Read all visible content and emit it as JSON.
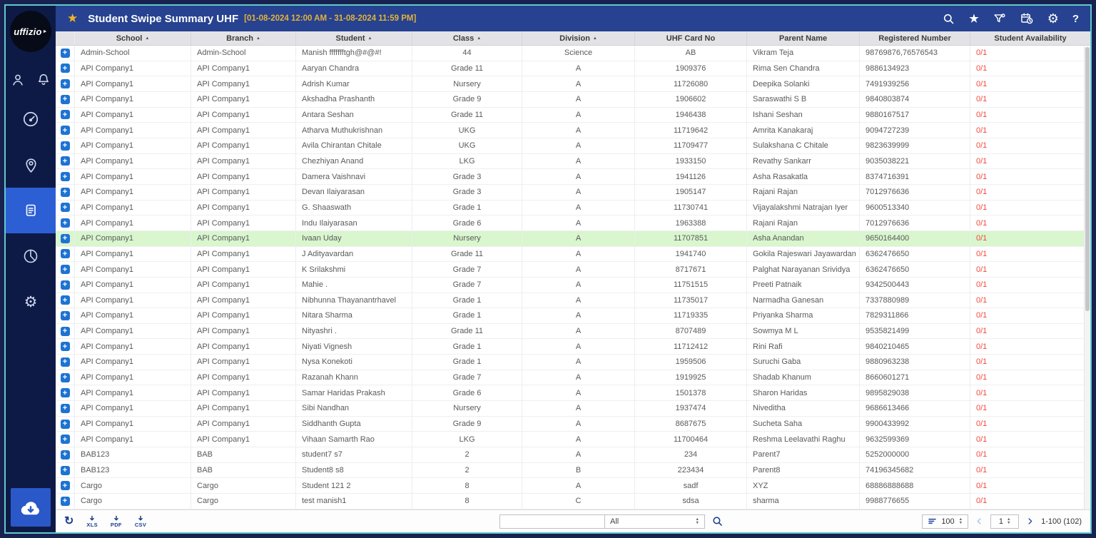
{
  "colors": {
    "frame_navy": "#182250",
    "accent_teal": "#62c9cc",
    "sidebar_navy": "#0e1a46",
    "active_blue": "#2c5fd4",
    "topbar_blue": "#264290",
    "gold": "#e3b23a",
    "highlight_green": "#d9f6ce",
    "availability_red": "#f0483c",
    "expand_blue": "#1e73d2"
  },
  "sidebar": {
    "logo_text": "uffizio",
    "items": [
      {
        "label": "users",
        "icon": "person-icon"
      },
      {
        "label": "notifications",
        "icon": "bell-icon"
      },
      {
        "label": "dashboard",
        "icon": "speedometer-icon"
      },
      {
        "label": "tracking",
        "icon": "location-person-icon"
      },
      {
        "label": "reports",
        "icon": "report-icon",
        "active": true
      },
      {
        "label": "analytics",
        "icon": "pie-chart-icon"
      },
      {
        "label": "settings",
        "icon": "gear-icon"
      },
      {
        "label": "download",
        "icon": "cloud-download-icon"
      }
    ]
  },
  "header": {
    "title": "Student Swipe Summary UHF",
    "date_range": "[01-08-2024 12:00 AM - 31-08-2024 11:59 PM]",
    "icons": [
      "search-icon",
      "favorite-star-icon",
      "filter-icon",
      "calendar-clock-icon",
      "gear-icon",
      "help-icon"
    ],
    "help_glyph": "?",
    "gear_glyph": "⚙"
  },
  "table": {
    "columns": [
      {
        "label": "",
        "sortable": false
      },
      {
        "label": "School",
        "sortable": true
      },
      {
        "label": "Branch",
        "sortable": true
      },
      {
        "label": "Student",
        "sortable": true
      },
      {
        "label": "Class",
        "sortable": true
      },
      {
        "label": "Division",
        "sortable": true
      },
      {
        "label": "UHF Card No",
        "sortable": false
      },
      {
        "label": "Parent Name",
        "sortable": false
      },
      {
        "label": "Registered Number",
        "sortable": false
      },
      {
        "label": "Student Availability",
        "sortable": false
      }
    ],
    "sort_asc_glyph": "▲",
    "highlighted_row_index": 12,
    "rows": [
      {
        "school": "Admin-School",
        "branch": "Admin-School",
        "student": "Manish ffffffftgh@#@#!",
        "klass": "44",
        "division": "Science",
        "uhf": "AB",
        "parent": "Vikram Teja",
        "registered": "98769876,76576543",
        "availability": "0/1"
      },
      {
        "school": "API Company1",
        "branch": "API Company1",
        "student": "Aaryan Chandra",
        "klass": "Grade 11",
        "division": "A",
        "uhf": "1909376",
        "parent": "Rima Sen Chandra",
        "registered": "9886134923",
        "availability": "0/1"
      },
      {
        "school": "API Company1",
        "branch": "API Company1",
        "student": "Adrish Kumar",
        "klass": "Nursery",
        "division": "A",
        "uhf": "11726080",
        "parent": "Deepika Solanki",
        "registered": "7491939256",
        "availability": "0/1"
      },
      {
        "school": "API Company1",
        "branch": "API Company1",
        "student": "Akshadha Prashanth",
        "klass": "Grade 9",
        "division": "A",
        "uhf": "1906602",
        "parent": "Saraswathi S B",
        "registered": "9840803874",
        "availability": "0/1"
      },
      {
        "school": "API Company1",
        "branch": "API Company1",
        "student": "Antara Seshan",
        "klass": "Grade 11",
        "division": "A",
        "uhf": "1946438",
        "parent": "Ishani Seshan",
        "registered": "9880167517",
        "availability": "0/1"
      },
      {
        "school": "API Company1",
        "branch": "API Company1",
        "student": "Atharva Muthukrishnan",
        "klass": "UKG",
        "division": "A",
        "uhf": "11719642",
        "parent": "Amrita Kanakaraj",
        "registered": "9094727239",
        "availability": "0/1"
      },
      {
        "school": "API Company1",
        "branch": "API Company1",
        "student": "Avila Chirantan Chitale",
        "klass": "UKG",
        "division": "A",
        "uhf": "11709477",
        "parent": "Sulakshana C Chitale",
        "registered": "9823639999",
        "availability": "0/1"
      },
      {
        "school": "API Company1",
        "branch": "API Company1",
        "student": "Chezhiyan Anand",
        "klass": "LKG",
        "division": "A",
        "uhf": "1933150",
        "parent": "Revathy Sankarr",
        "registered": "9035038221",
        "availability": "0/1"
      },
      {
        "school": "API Company1",
        "branch": "API Company1",
        "student": "Damera Vaishnavi",
        "klass": "Grade 3",
        "division": "A",
        "uhf": "1941126",
        "parent": "Asha Rasakatla",
        "registered": "8374716391",
        "availability": "0/1"
      },
      {
        "school": "API Company1",
        "branch": "API Company1",
        "student": "Devan Ilaiyarasan",
        "klass": "Grade 3",
        "division": "A",
        "uhf": "1905147",
        "parent": "Rajani Rajan",
        "registered": "7012976636",
        "availability": "0/1"
      },
      {
        "school": "API Company1",
        "branch": "API Company1",
        "student": "G. Shaaswath",
        "klass": "Grade 1",
        "division": "A",
        "uhf": "11730741",
        "parent": "Vijayalakshmi Natrajan Iyer",
        "registered": "9600513340",
        "availability": "0/1"
      },
      {
        "school": "API Company1",
        "branch": "API Company1",
        "student": "Indu Ilaiyarasan",
        "klass": "Grade 6",
        "division": "A",
        "uhf": "1963388",
        "parent": "Rajani Rajan",
        "registered": "7012976636",
        "availability": "0/1"
      },
      {
        "school": "API Company1",
        "branch": "API Company1",
        "student": "Ivaan Uday",
        "klass": "Nursery",
        "division": "A",
        "uhf": "11707851",
        "parent": "Asha Anandan",
        "registered": "9650164400",
        "availability": "0/1"
      },
      {
        "school": "API Company1",
        "branch": "API Company1",
        "student": "J Adityavardan",
        "klass": "Grade 11",
        "division": "A",
        "uhf": "1941740",
        "parent": "Gokila Rajeswari Jayawardan",
        "registered": "6362476650",
        "availability": "0/1"
      },
      {
        "school": "API Company1",
        "branch": "API Company1",
        "student": "K Srilakshmi",
        "klass": "Grade 7",
        "division": "A",
        "uhf": "8717671",
        "parent": "Palghat Narayanan Srividya",
        "registered": "6362476650",
        "availability": "0/1"
      },
      {
        "school": "API Company1",
        "branch": "API Company1",
        "student": "Mahie .",
        "klass": "Grade 7",
        "division": "A",
        "uhf": "11751515",
        "parent": "Preeti Patnaik",
        "registered": "9342500443",
        "availability": "0/1"
      },
      {
        "school": "API Company1",
        "branch": "API Company1",
        "student": "Nibhunna Thayanantrhavel",
        "klass": "Grade 1",
        "division": "A",
        "uhf": "11735017",
        "parent": "Narmadha Ganesan",
        "registered": "7337880989",
        "availability": "0/1"
      },
      {
        "school": "API Company1",
        "branch": "API Company1",
        "student": "Nitara Sharma",
        "klass": "Grade 1",
        "division": "A",
        "uhf": "11719335",
        "parent": "Priyanka Sharma",
        "registered": "7829311866",
        "availability": "0/1"
      },
      {
        "school": "API Company1",
        "branch": "API Company1",
        "student": "Nityashri .",
        "klass": "Grade 11",
        "division": "A",
        "uhf": "8707489",
        "parent": "Sowmya M L",
        "registered": "9535821499",
        "availability": "0/1"
      },
      {
        "school": "API Company1",
        "branch": "API Company1",
        "student": "Niyati Vignesh",
        "klass": "Grade 1",
        "division": "A",
        "uhf": "11712412",
        "parent": "Rini Rafi",
        "registered": "9840210465",
        "availability": "0/1"
      },
      {
        "school": "API Company1",
        "branch": "API Company1",
        "student": "Nysa Konekoti",
        "klass": "Grade 1",
        "division": "A",
        "uhf": "1959506",
        "parent": "Suruchi Gaba",
        "registered": "9880963238",
        "availability": "0/1"
      },
      {
        "school": "API Company1",
        "branch": "API Company1",
        "student": "Razanah Khann",
        "klass": "Grade 7",
        "division": "A",
        "uhf": "1919925",
        "parent": "Shadab Khanum",
        "registered": "8660601271",
        "availability": "0/1"
      },
      {
        "school": "API Company1",
        "branch": "API Company1",
        "student": "Samar Haridas Prakash",
        "klass": "Grade 6",
        "division": "A",
        "uhf": "1501378",
        "parent": "Sharon Haridas",
        "registered": "9895829038",
        "availability": "0/1"
      },
      {
        "school": "API Company1",
        "branch": "API Company1",
        "student": "Sibi Nandhan",
        "klass": "Nursery",
        "division": "A",
        "uhf": "1937474",
        "parent": "Niveditha",
        "registered": "9686613466",
        "availability": "0/1"
      },
      {
        "school": "API Company1",
        "branch": "API Company1",
        "student": "Siddhanth Gupta",
        "klass": "Grade 9",
        "division": "A",
        "uhf": "8687675",
        "parent": "Sucheta Saha",
        "registered": "9900433992",
        "availability": "0/1"
      },
      {
        "school": "API Company1",
        "branch": "API Company1",
        "student": "Vihaan Samarth Rao",
        "klass": "LKG",
        "division": "A",
        "uhf": "11700464",
        "parent": "Reshma Leelavathi Raghu",
        "registered": "9632599369",
        "availability": "0/1"
      },
      {
        "school": "BAB123",
        "branch": "BAB",
        "student": "student7 s7",
        "klass": "2",
        "division": "A",
        "uhf": "234",
        "parent": "Parent7",
        "registered": "5252000000",
        "availability": "0/1"
      },
      {
        "school": "BAB123",
        "branch": "BAB",
        "student": "Student8 s8",
        "klass": "2",
        "division": "B",
        "uhf": "223434",
        "parent": "Parent8",
        "registered": "74196345682",
        "availability": "0/1"
      },
      {
        "school": "Cargo",
        "branch": "Cargo",
        "student": "Student 121 2",
        "klass": "8",
        "division": "A",
        "uhf": "sadf",
        "parent": "XYZ",
        "registered": "68886888688",
        "availability": "0/1"
      },
      {
        "school": "Cargo",
        "branch": "Cargo",
        "student": "test manish1",
        "klass": "8",
        "division": "C",
        "uhf": "sdsa",
        "parent": "sharma",
        "registered": "9988776655",
        "availability": "0/1"
      }
    ]
  },
  "footer": {
    "refresh_glyph": "↻",
    "export": {
      "xls": "XLS",
      "pdf": "PDF",
      "csv": "CSV"
    },
    "search_value": "",
    "search_placeholder": "",
    "filter_selected": "All",
    "page_size": "100",
    "current_page": "1",
    "range_label": "1-100 (102)"
  }
}
